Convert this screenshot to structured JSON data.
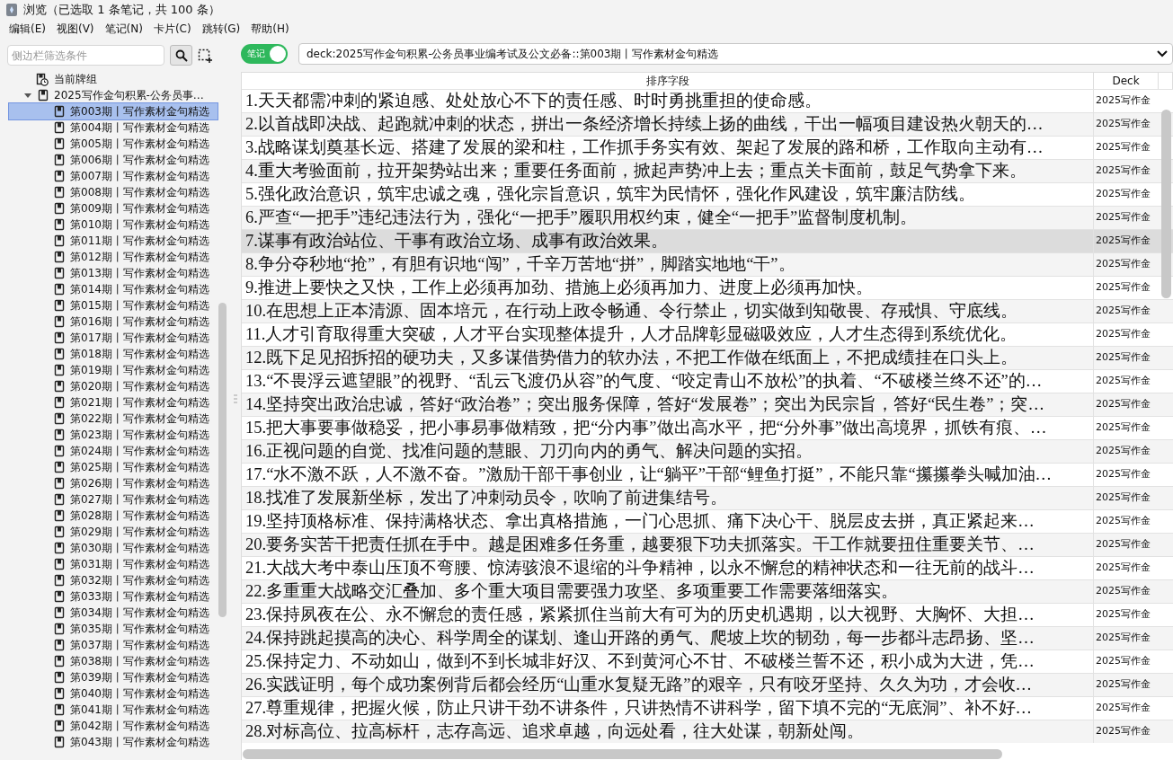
{
  "window": {
    "title": "浏览（已选取 1 条笔记，共 100 条）"
  },
  "menu": [
    "编辑(E)",
    "视图(V)",
    "笔记(N)",
    "卡片(C)",
    "跳转(G)",
    "帮助(H)"
  ],
  "sidebar": {
    "search": {
      "placeholder": "侧边栏筛选条件"
    },
    "tree": [
      {
        "label": "当前牌组",
        "kind": "current"
      },
      {
        "label": "2025写作金句积累-公务员事…",
        "kind": "deck",
        "expanded": true,
        "children": [
          {
            "label": "第003期丨写作素材金句精选",
            "selected": true
          },
          {
            "label": "第004期丨写作素材金句精选",
            "selected": false
          },
          {
            "label": "第005期丨写作素材金句精选",
            "selected": false
          },
          {
            "label": "第006期丨写作素材金句精选",
            "selected": false
          },
          {
            "label": "第007期丨写作素材金句精选",
            "selected": false
          },
          {
            "label": "第008期丨写作素材金句精选",
            "selected": false
          },
          {
            "label": "第009期丨写作素材金句精选",
            "selected": false
          },
          {
            "label": "第010期丨写作素材金句精选",
            "selected": false
          },
          {
            "label": "第011期丨写作素材金句精选",
            "selected": false
          },
          {
            "label": "第012期丨写作素材金句精选",
            "selected": false
          },
          {
            "label": "第013期丨写作素材金句精选",
            "selected": false
          },
          {
            "label": "第014期丨写作素材金句精选",
            "selected": false
          },
          {
            "label": "第015期丨写作素材金句精选",
            "selected": false
          },
          {
            "label": "第016期丨写作素材金句精选",
            "selected": false
          },
          {
            "label": "第017期丨写作素材金句精选",
            "selected": false
          },
          {
            "label": "第018期丨写作素材金句精选",
            "selected": false
          },
          {
            "label": "第019期丨写作素材金句精选",
            "selected": false
          },
          {
            "label": "第020期丨写作素材金句精选",
            "selected": false
          },
          {
            "label": "第021期丨写作素材金句精选",
            "selected": false
          },
          {
            "label": "第022期丨写作素材金句精选",
            "selected": false
          },
          {
            "label": "第023期丨写作素材金句精选",
            "selected": false
          },
          {
            "label": "第024期丨写作素材金句精选",
            "selected": false
          },
          {
            "label": "第025期丨写作素材金句精选",
            "selected": false
          },
          {
            "label": "第026期丨写作素材金句精选",
            "selected": false
          },
          {
            "label": "第027期丨写作素材金句精选",
            "selected": false
          },
          {
            "label": "第028期丨写作素材金句精选",
            "selected": false
          },
          {
            "label": "第029期丨写作素材金句精选",
            "selected": false
          },
          {
            "label": "第030期丨写作素材金句精选",
            "selected": false
          },
          {
            "label": "第031期丨写作素材金句精选",
            "selected": false
          },
          {
            "label": "第032期丨写作素材金句精选",
            "selected": false
          },
          {
            "label": "第033期丨写作素材金句精选",
            "selected": false
          },
          {
            "label": "第034期丨写作素材金句精选",
            "selected": false
          },
          {
            "label": "第035期丨写作素材金句精选",
            "selected": false
          },
          {
            "label": "第037期丨写作素材金句精选",
            "selected": false
          },
          {
            "label": "第038期丨写作素材金句精选",
            "selected": false
          },
          {
            "label": "第039期丨写作素材金句精选",
            "selected": false
          },
          {
            "label": "第040期丨写作素材金句精选",
            "selected": false
          },
          {
            "label": "第041期丨写作素材金句精选",
            "selected": false
          },
          {
            "label": "第042期丨写作素材金句精选",
            "selected": false
          },
          {
            "label": "第043期丨写作素材金句精选",
            "selected": false
          }
        ]
      }
    ]
  },
  "toolbar": {
    "mode_toggle": {
      "label": "笔记",
      "on": true
    },
    "search": {
      "value": "deck:2025写作金句积累-公务员事业编考试及公文必备::第003期丨写作素材金句精选"
    }
  },
  "table": {
    "columns": [
      "排序字段",
      "Deck"
    ],
    "rows": [
      {
        "cells": [
          "1.天天都需冲刺的紧迫感、处处放心不下的责任感、时时勇挑重担的使命感。",
          "2025写作金"
        ],
        "selected": false
      },
      {
        "cells": [
          "2.以首战即决战、起跑就冲刺的状态，拼出一条经济增长持续上扬的曲线，干出一幅项目建设热火朝天的…",
          "2025写作金"
        ],
        "selected": false
      },
      {
        "cells": [
          "3.战略谋划奠基长远、搭建了发展的梁和柱，工作抓手务实有效、架起了发展的路和桥，工作取向主动有…",
          "2025写作金"
        ],
        "selected": false
      },
      {
        "cells": [
          "4.重大考验面前，拉开架势站出来；重要任务面前，掀起声势冲上去；重点关卡面前，鼓足气势拿下来。",
          "2025写作金"
        ],
        "selected": false
      },
      {
        "cells": [
          "5.强化政治意识，筑牢忠诚之魂，强化宗旨意识，筑牢为民情怀，强化作风建设，筑牢廉洁防线。",
          "2025写作金"
        ],
        "selected": false
      },
      {
        "cells": [
          "6.严查“一把手”违纪违法行为，强化“一把手”履职用权约束，健全“一把手”监督制度机制。",
          "2025写作金"
        ],
        "selected": false
      },
      {
        "cells": [
          "7.谋事有政治站位、干事有政治立场、成事有政治效果。",
          "2025写作金"
        ],
        "selected": true
      },
      {
        "cells": [
          "8.争分夺秒地“抢”，有胆有识地“闯”，千辛万苦地“拼”，脚踏实地地“干”。",
          "2025写作金"
        ],
        "selected": false
      },
      {
        "cells": [
          "9.推进上要快之又快，工作上必须再加劲、措施上必须再加力、进度上必须再加快。",
          "2025写作金"
        ],
        "selected": false
      },
      {
        "cells": [
          "10.在思想上正本清源、固本培元，在行动上政令畅通、令行禁止，切实做到知敬畏、存戒惧、守底线。",
          "2025写作金"
        ],
        "selected": false
      },
      {
        "cells": [
          "11.人才引育取得重大突破，人才平台实现整体提升，人才品牌彰显磁吸效应，人才生态得到系统优化。",
          "2025写作金"
        ],
        "selected": false
      },
      {
        "cells": [
          "12.既下足见招拆招的硬功夫，又多谋借势借力的软办法，不把工作做在纸面上，不把成绩挂在口头上。",
          "2025写作金"
        ],
        "selected": false
      },
      {
        "cells": [
          "13.“不畏浮云遮望眼”的视野、“乱云飞渡仍从容”的气度、“咬定青山不放松”的执着、“不破楼兰终不还”的…",
          "2025写作金"
        ],
        "selected": false
      },
      {
        "cells": [
          "14.坚持突出政治忠诚，答好“政治卷”；突出服务保障，答好“发展卷”；突出为民宗旨，答好“民生卷”；突…",
          "2025写作金"
        ],
        "selected": false
      },
      {
        "cells": [
          "15.把大事要事做稳妥，把小事易事做精致，把“分内事”做出高水平，把“分外事”做出高境界，抓铁有痕、…",
          "2025写作金"
        ],
        "selected": false
      },
      {
        "cells": [
          "16.正视问题的自觉、找准问题的慧眼、刀刃向内的勇气、解决问题的实招。",
          "2025写作金"
        ],
        "selected": false
      },
      {
        "cells": [
          "17.“水不激不跃，人不激不奋。”激励干部干事创业，让“躺平”干部“鲤鱼打挺”，不能只靠“攥攥拳头喊加油…",
          "2025写作金"
        ],
        "selected": false
      },
      {
        "cells": [
          "18.找准了发展新坐标，发出了冲刺动员令，吹响了前进集结号。",
          "2025写作金"
        ],
        "selected": false
      },
      {
        "cells": [
          "19.坚持顶格标准、保持满格状态、拿出真格措施，一门心思抓、痛下决心干、脱层皮去拼，真正紧起来…",
          "2025写作金"
        ],
        "selected": false
      },
      {
        "cells": [
          "20.要务实苦干把责任抓在手中。越是困难多任务重，越要狠下功夫抓落实。干工作就要扭住重要关节、…",
          "2025写作金"
        ],
        "selected": false
      },
      {
        "cells": [
          "21.大战大考中泰山压顶不弯腰、惊涛骇浪不退缩的斗争精神，以永不懈怠的精神状态和一往无前的战斗…",
          "2025写作金"
        ],
        "selected": false
      },
      {
        "cells": [
          "22.多重重大战略交汇叠加、多个重大项目需要强力攻坚、多项重要工作需要落细落实。",
          "2025写作金"
        ],
        "selected": false
      },
      {
        "cells": [
          "23.保持夙夜在公、永不懈怠的责任感，紧紧抓住当前大有可为的历史机遇期，以大视野、大胸怀、大担…",
          "2025写作金"
        ],
        "selected": false
      },
      {
        "cells": [
          "24.保持跳起摸高的决心、科学周全的谋划、逢山开路的勇气、爬坡上坎的韧劲，每一步都斗志昂扬、坚…",
          "2025写作金"
        ],
        "selected": false
      },
      {
        "cells": [
          "25.保持定力、不动如山，做到不到长城非好汉、不到黄河心不甘、不破楼兰誓不还，积小成为大进，凭…",
          "2025写作金"
        ],
        "selected": false
      },
      {
        "cells": [
          "26.实践证明，每个成功案例背后都会经历“山重水复疑无路”的艰辛，只有咬牙坚持、久久为功，才会收…",
          "2025写作金"
        ],
        "selected": false
      },
      {
        "cells": [
          "27.尊重规律，把握火候，防止只讲干劲不讲条件，只讲热情不讲科学，留下填不完的“无底洞”、补不好…",
          "2025写作金"
        ],
        "selected": false
      },
      {
        "cells": [
          "28.对标高位、拉高标杆，志存高远、追求卓越，向远处看，往大处谋，朝新处闯。",
          "2025写作金"
        ],
        "selected": false
      }
    ]
  }
}
